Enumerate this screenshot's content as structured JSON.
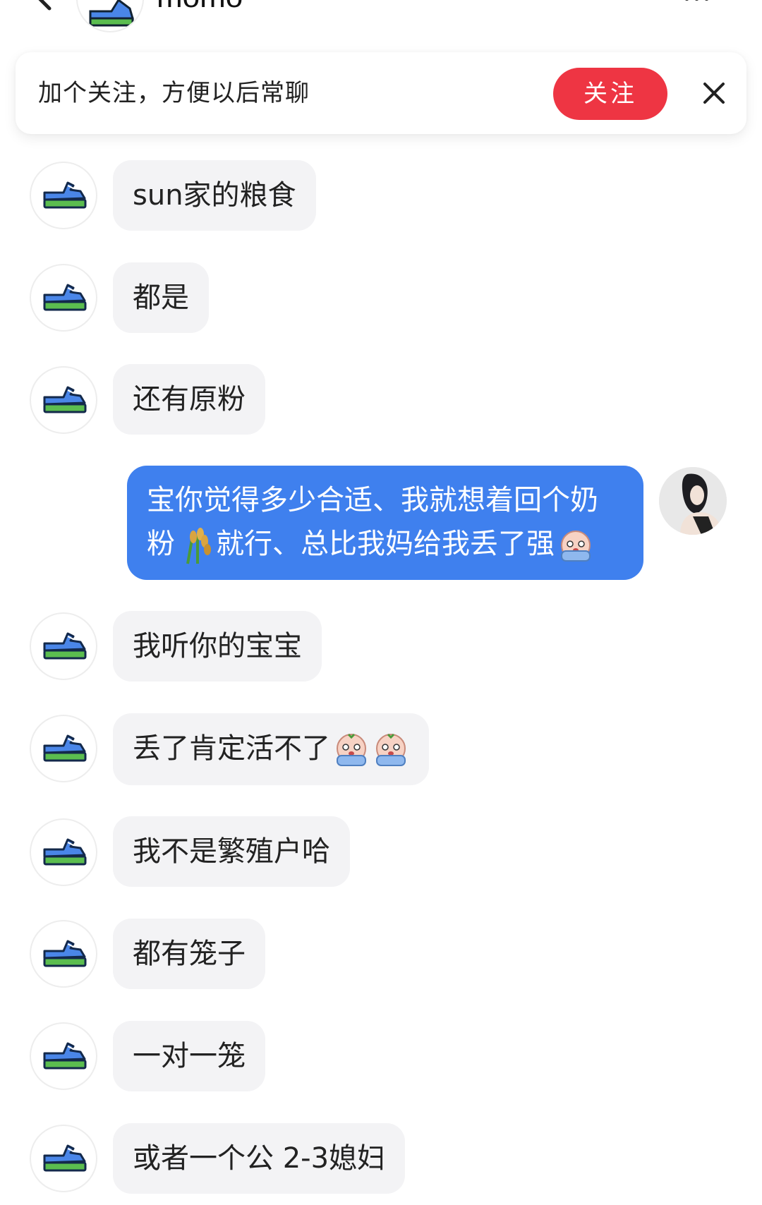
{
  "header": {
    "name": "momo"
  },
  "follow_prompt": {
    "text": "加个关注，方便以后常聊",
    "button_label": "关注"
  },
  "messages": [
    {
      "side": "in",
      "text": "sun家的粮食"
    },
    {
      "side": "in",
      "text": "都是"
    },
    {
      "side": "in",
      "text": "还有原粉"
    },
    {
      "side": "out",
      "line1": "宝你觉得多少合适、我就想着回个奶",
      "line2_a": "粉",
      "line2_b": "就行、总比我妈给我丢了强"
    },
    {
      "side": "in",
      "text": "我听你的宝宝"
    },
    {
      "side": "in",
      "text": "丢了肯定活不了"
    },
    {
      "side": "in",
      "text": "我不是繁殖户哈"
    },
    {
      "side": "in",
      "text": "都有笼子"
    },
    {
      "side": "in",
      "text": "一对一笼"
    },
    {
      "side": "in",
      "text": "或者一个公 2-3媳妇"
    }
  ],
  "icons": {
    "back": "chevron-left-icon",
    "more": "more-dots-icon",
    "close": "close-icon",
    "contact_avatar": "sneaker-avatar",
    "self_avatar": "self-avatar-photo",
    "rice_emoji": "rice-emoji",
    "crying_emoji": "crying-emoji"
  },
  "colors": {
    "follow_button": "#ee3543",
    "outgoing_bubble": "#3f80ee",
    "incoming_bubble": "#f3f3f5"
  }
}
